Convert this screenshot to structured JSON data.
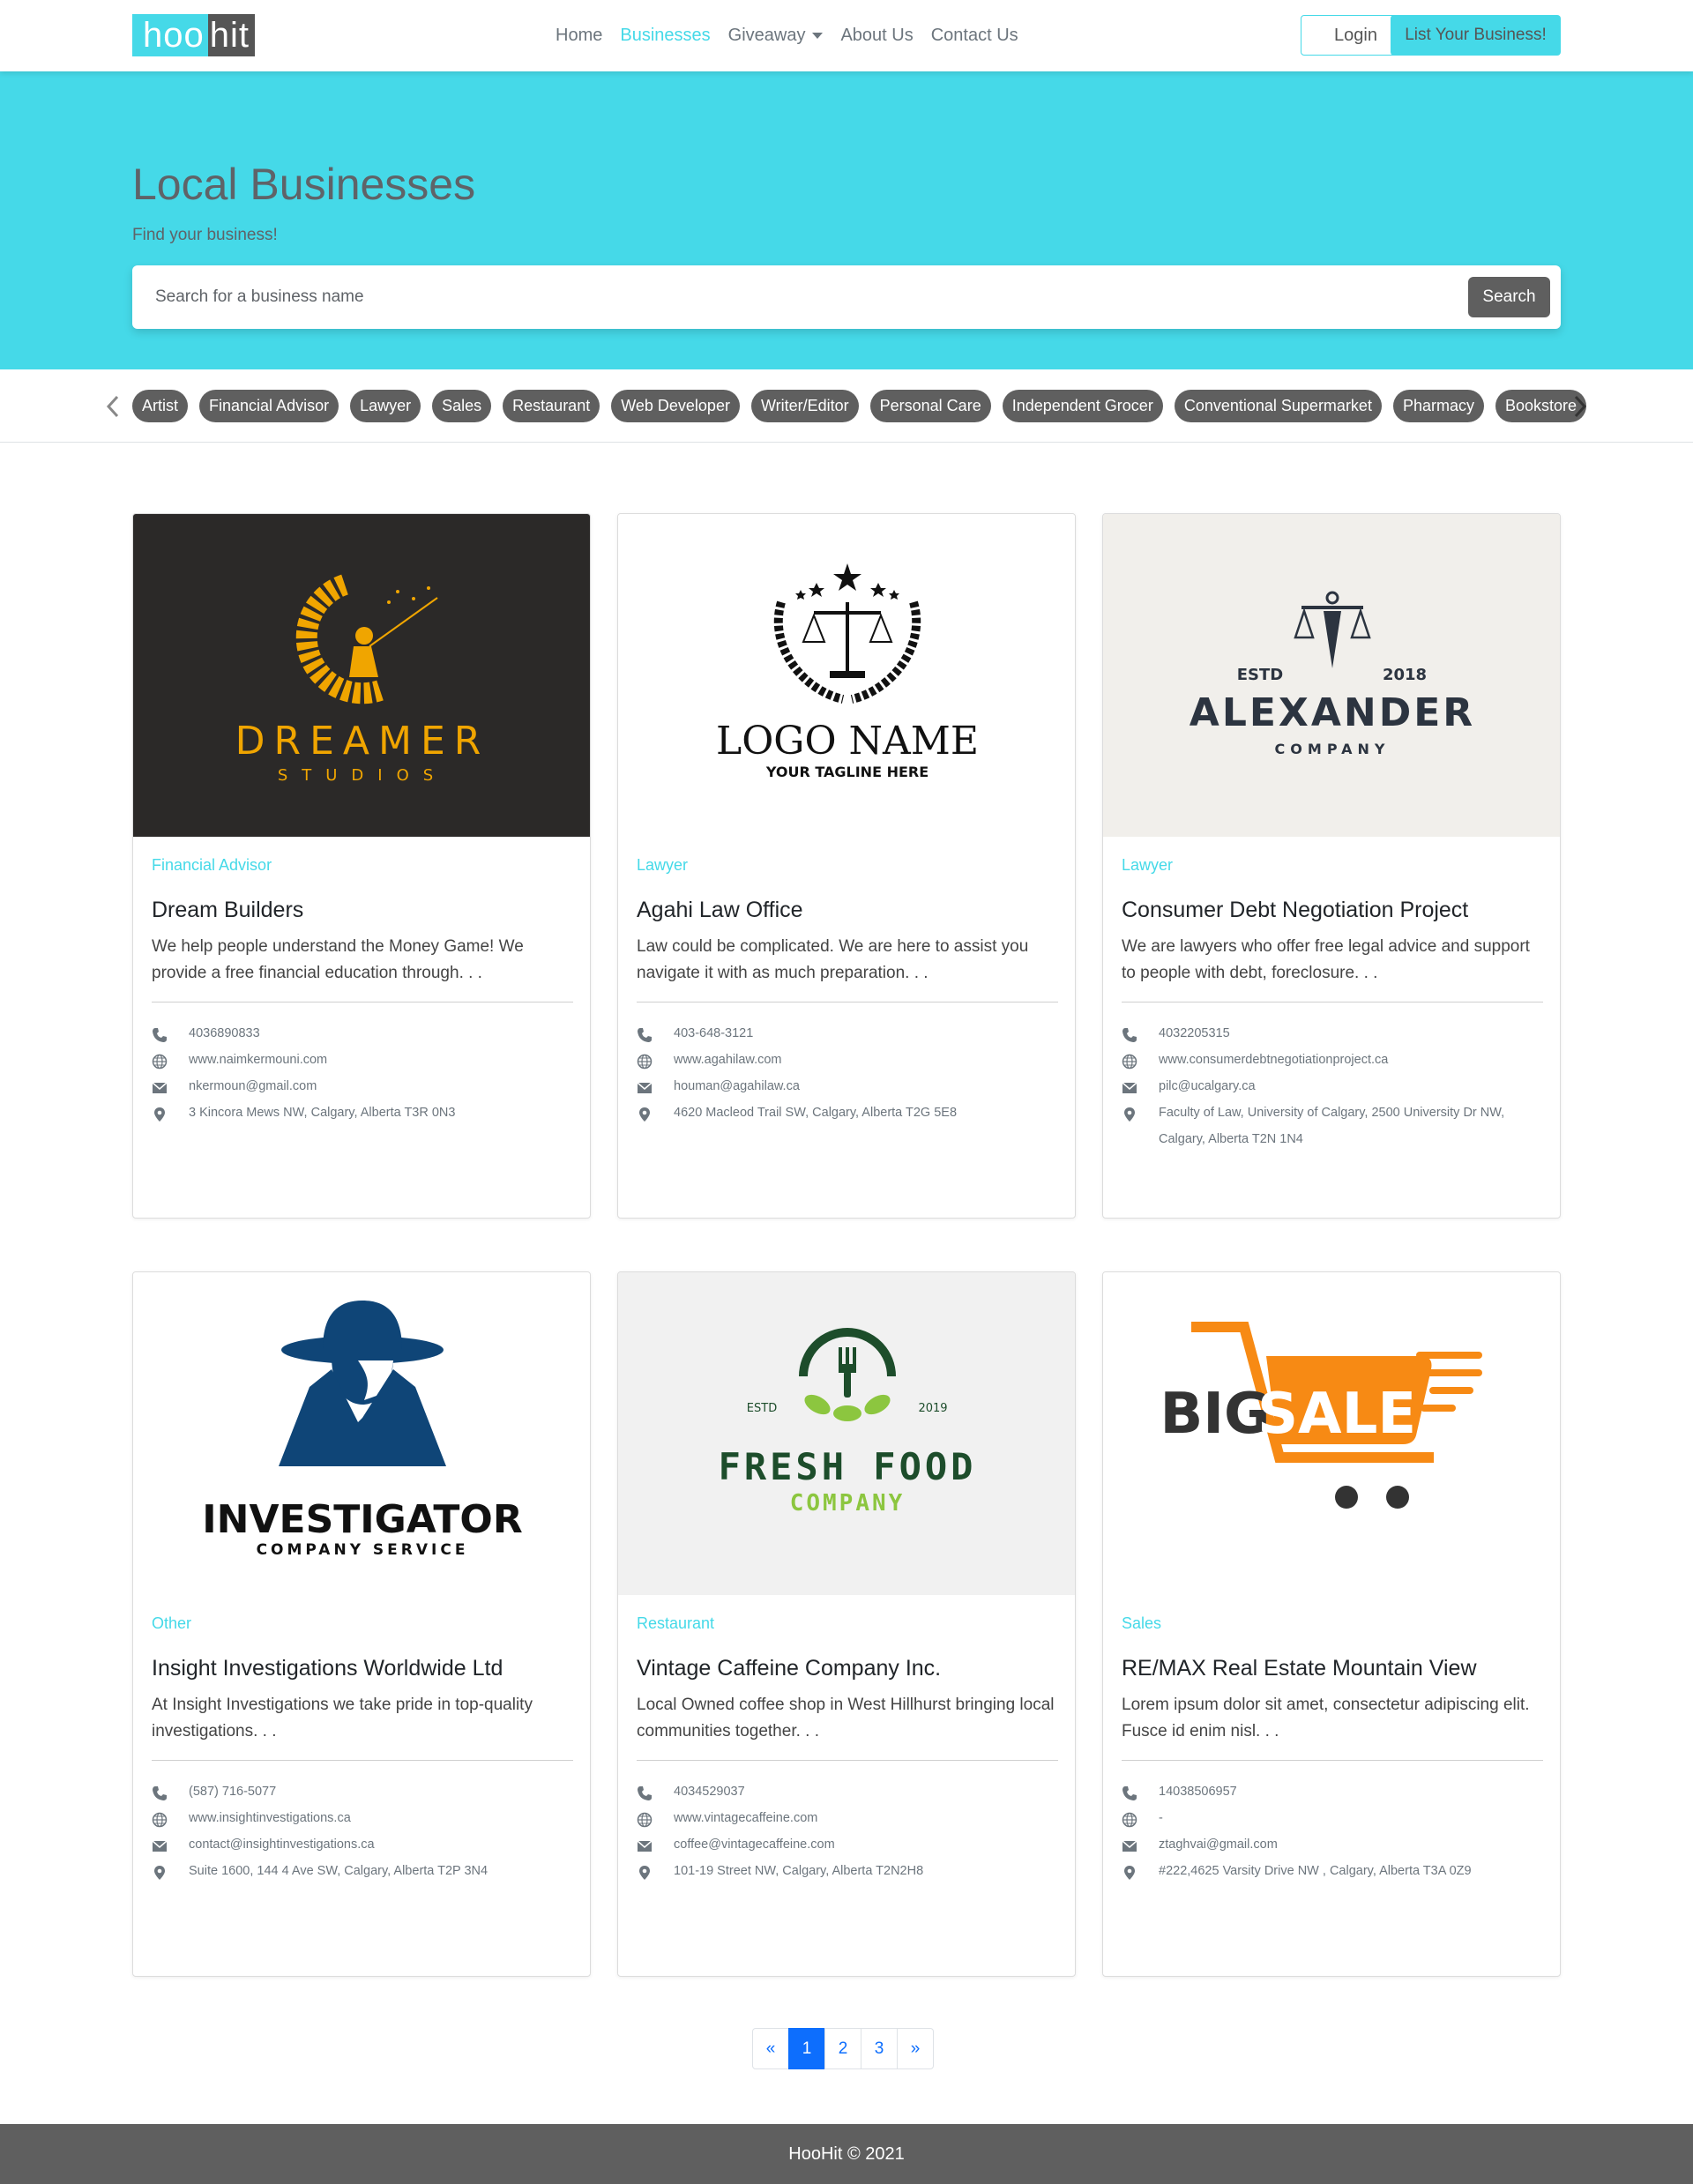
{
  "brand": {
    "part1": "hoo",
    "part2": "hit"
  },
  "nav": {
    "links": [
      "Home",
      "Businesses",
      "Giveaway",
      "About Us",
      "Contact Us"
    ],
    "login": "Login",
    "list_business": "List Your Business!"
  },
  "hero": {
    "title": "Local Businesses",
    "subtitle": "Find your business!",
    "search_placeholder": "Search for a business name",
    "search_button": "Search"
  },
  "categories": [
    "Artist",
    "Financial Advisor",
    "Lawyer",
    "Sales",
    "Restaurant",
    "Web Developer",
    "Writer/Editor",
    "Personal Care",
    "Independent Grocer",
    "Conventional Supermarket",
    "Pharmacy",
    "Bookstore"
  ],
  "cards": [
    {
      "category": "Financial Advisor",
      "title": "Dream Builders",
      "desc": "We help people understand the Money Game! We provide a free financial education through. . .",
      "phone": "4036890833",
      "website": "www.naimkermouni.com",
      "email": "nkermoun@gmail.com",
      "address": "3 Kincora Mews NW, Calgary, Alberta T3R 0N3",
      "logo": {
        "line1": "DREAMER",
        "line2": "STUDIOS"
      }
    },
    {
      "category": "Lawyer",
      "title": "Agahi Law Office",
      "desc": "Law could be complicated. We are here to assist you navigate it with as much preparation. . .",
      "phone": "403-648-3121",
      "website": "www.agahilaw.com",
      "email": "houman@agahilaw.ca",
      "address": "4620 Macleod Trail SW, Calgary, Alberta T2G 5E8",
      "logo": {
        "line1": "LOGO NAME",
        "line2": "YOUR TAGLINE HERE"
      }
    },
    {
      "category": "Lawyer",
      "title": "Consumer Debt Negotiation Project",
      "desc": "We are lawyers who offer free legal advice and support to people with debt, foreclosure. . .",
      "phone": "4032205315",
      "website": "www.consumerdebtnegotiationproject.ca",
      "email": "pilc@ucalgary.ca",
      "address": "Faculty of Law, University of Calgary, 2500 University Dr NW, Calgary, Alberta T2N 1N4",
      "logo": {
        "estd": "ESTD",
        "year": "2018",
        "line1": "ALEXANDER",
        "line2": "COMPANY"
      }
    },
    {
      "category": "Other",
      "title": "Insight Investigations Worldwide Ltd",
      "desc": "At Insight Investigations we take pride in top-quality investigations. . .",
      "phone": "(587) 716-5077",
      "website": "www.insightinvestigations.ca",
      "email": "contact@insightinvestigations.ca",
      "address": "Suite 1600, 144 4 Ave SW, Calgary, Alberta T2P 3N4",
      "logo": {
        "line1": "INVESTIGATOR",
        "line2": "COMPANY SERVICE"
      }
    },
    {
      "category": "Restaurant",
      "title": "Vintage Caffeine Company Inc.",
      "desc": "Local Owned coffee shop in West Hillhurst bringing local communities together. . .",
      "phone": "4034529037",
      "website": "www.vintagecaffeine.com",
      "email": "coffee@vintagecaffeine.com",
      "address": "101-19 Street NW, Calgary, Alberta T2N2H8",
      "logo": {
        "estd": "ESTD",
        "year": "2019",
        "line1": "FRESH FOOD",
        "line2": "COMPANY"
      }
    },
    {
      "category": "Sales",
      "title": "RE/MAX Real Estate Mountain View",
      "desc": "Lorem ipsum dolor sit amet, consectetur adipiscing elit. Fusce id enim nisl. . .",
      "phone": "14038506957",
      "website": "-",
      "email": "ztaghvai@gmail.com",
      "address": "#222,4625 Varsity Drive NW , Calgary, Alberta T3A 0Z9",
      "logo": {
        "line1": "BIG",
        "line2": "SALE"
      }
    }
  ],
  "pagination": [
    "«",
    "1",
    "2",
    "3",
    "»"
  ],
  "footer": "HooHit © 2021",
  "colors": {
    "accent": "#45d9e8",
    "dark": "#5f5f5f",
    "primary": "#0d6efd"
  }
}
